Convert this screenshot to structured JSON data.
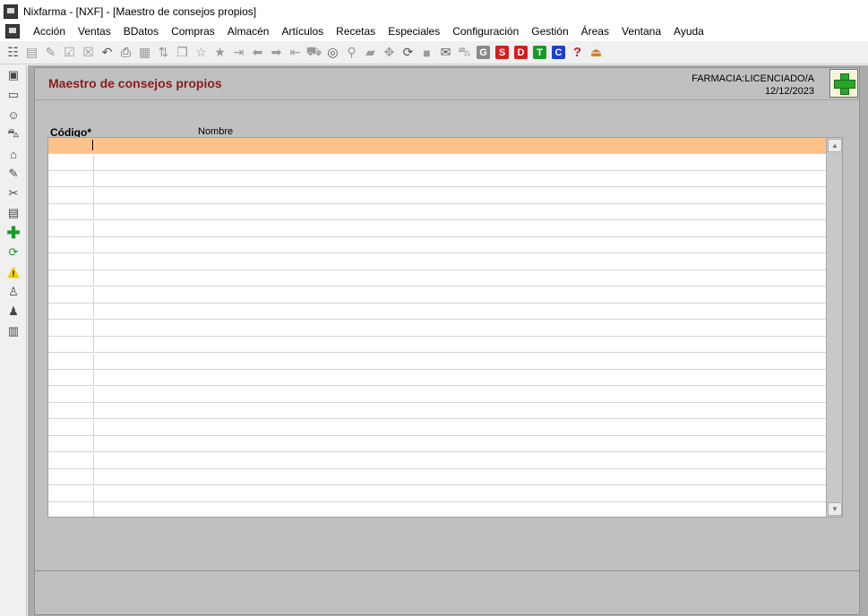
{
  "window": {
    "title": "Nixfarma - [NXF] - [Maestro de consejos propios]"
  },
  "menu": {
    "items": [
      "Acción",
      "Ventas",
      "BDatos",
      "Compras",
      "Almacén",
      "Artículos",
      "Recetas",
      "Especiales",
      "Configuración",
      "Gestión",
      "Áreas",
      "Ventana",
      "Ayuda"
    ]
  },
  "toolbar": {
    "letter_buttons": [
      "G",
      "S",
      "D",
      "T",
      "C"
    ],
    "help_label": "?"
  },
  "form": {
    "title": "Maestro de consejos propios",
    "farmacia": "FARMACIA:LICENCIADO/A",
    "fecha": "12/12/2023",
    "columns": {
      "codigo": "Código*",
      "nombre": "Nombre"
    }
  },
  "colors": {
    "form_title": "#8b1a1a",
    "selected_row": "#fcc28a",
    "add_icon": "#28a628"
  }
}
